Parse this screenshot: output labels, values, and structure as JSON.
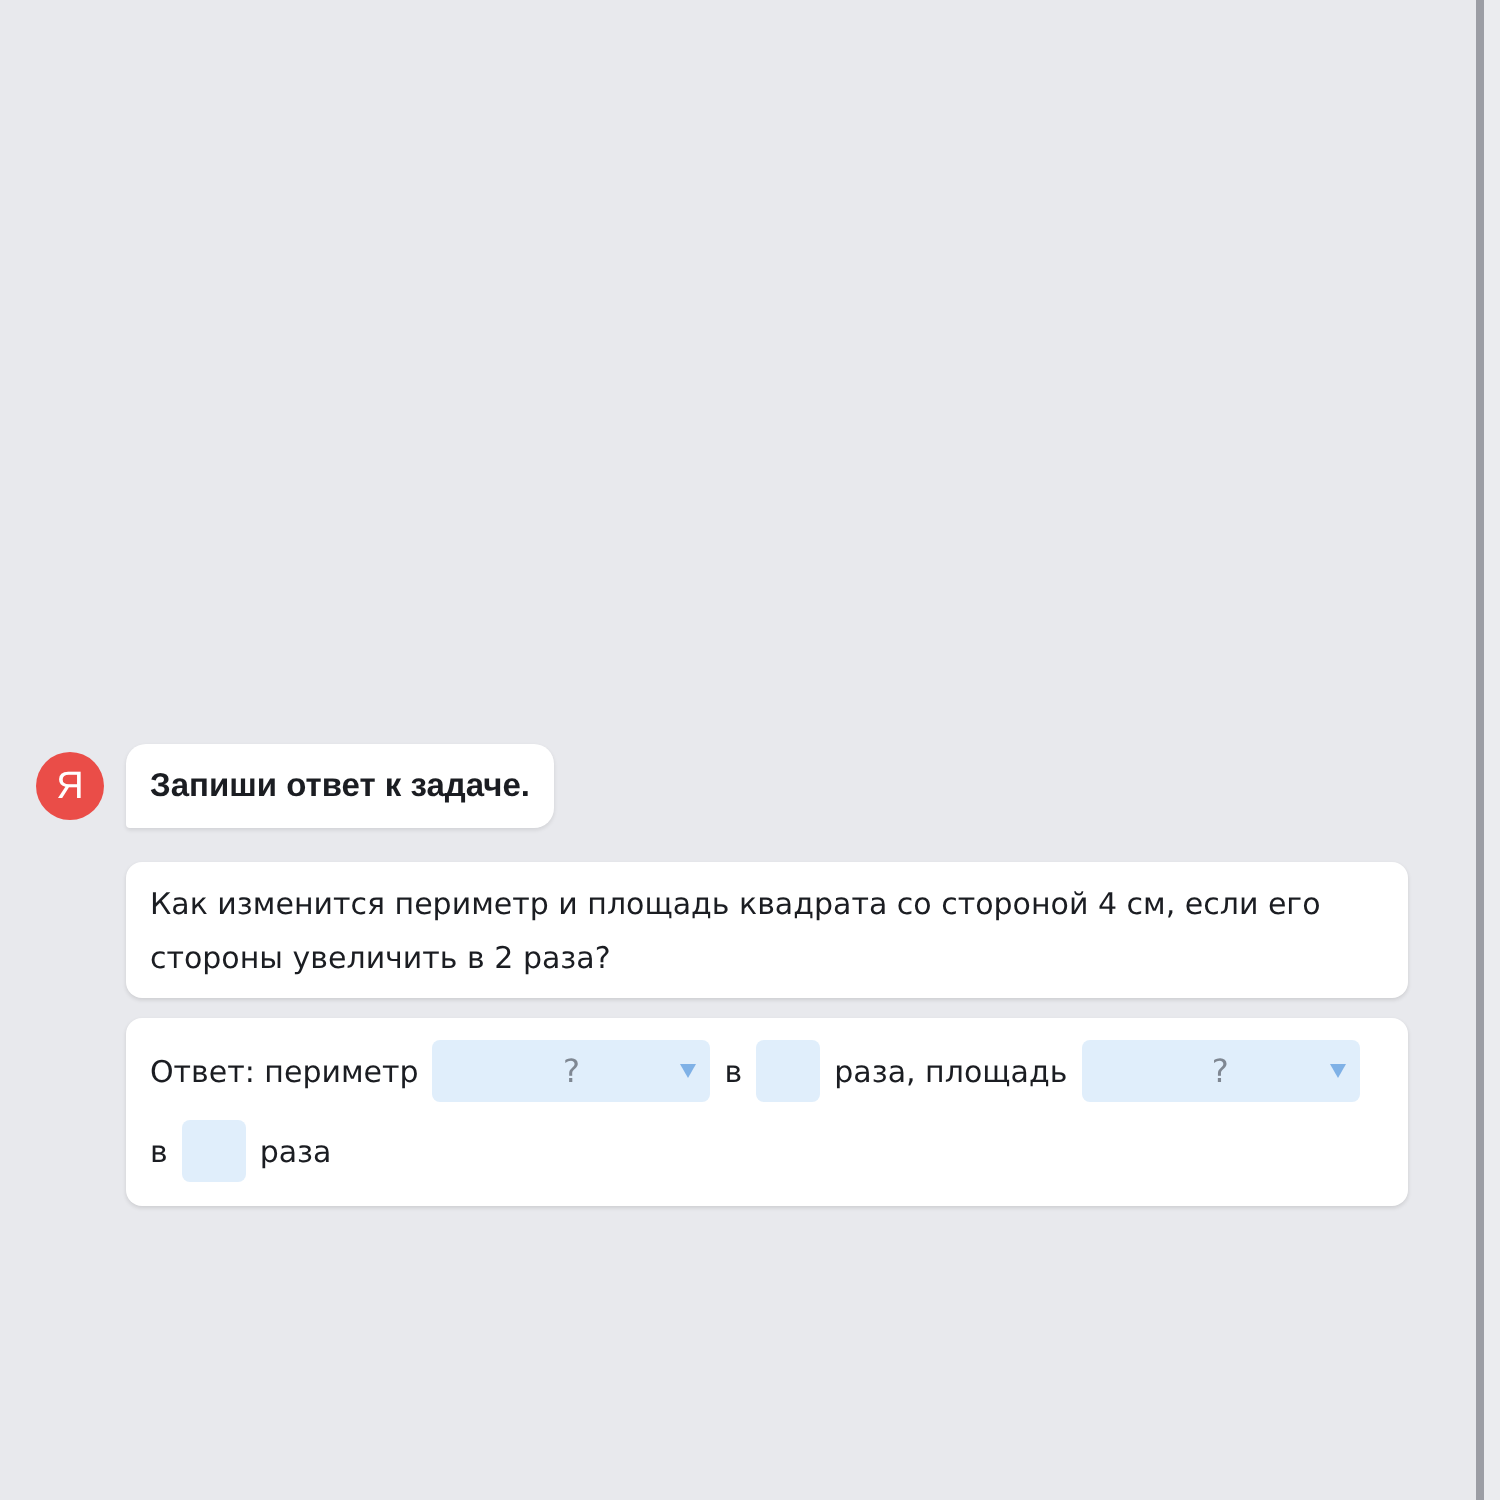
{
  "assistant": {
    "avatar_letter": "Я",
    "message": "Запиши ответ к задаче."
  },
  "task": {
    "question": "Как изменится периметр и площадь квадрата со стороной 4 см, если его стороны увеличить в 2 раза?"
  },
  "answer": {
    "parts": [
      {
        "kind": "text",
        "text": "Ответ: периметр"
      },
      {
        "kind": "select",
        "placeholder": "?"
      },
      {
        "kind": "text",
        "text": "в"
      },
      {
        "kind": "input"
      },
      {
        "kind": "text",
        "text": "раза, площадь"
      },
      {
        "kind": "select",
        "placeholder": "?"
      },
      {
        "kind": "text",
        "text": "в"
      },
      {
        "kind": "input"
      },
      {
        "kind": "text",
        "text": "раза"
      }
    ]
  }
}
